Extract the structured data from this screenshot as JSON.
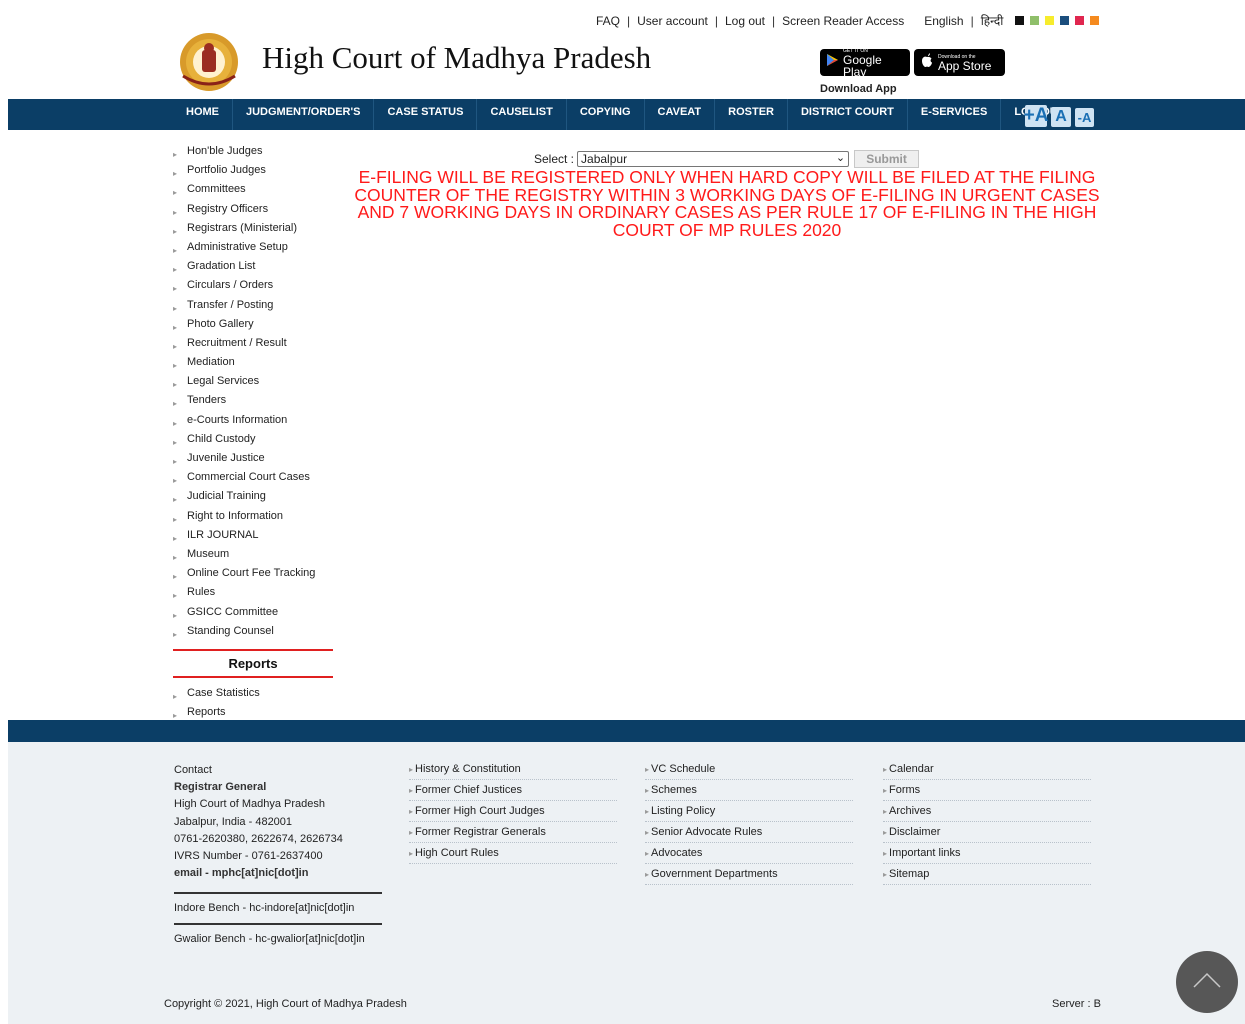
{
  "topbar": {
    "links": [
      "FAQ",
      "User account",
      "Log out",
      "Screen Reader Access"
    ],
    "lang_en": "English",
    "lang_sep": "|",
    "lang_hi": "हिन्दी",
    "swatches": [
      "#111111",
      "#8fbf6a",
      "#f7ec2c",
      "#1b4e7d",
      "#e0264f",
      "#f58a1f"
    ]
  },
  "header": {
    "title": "High Court of Madhya Pradesh",
    "google_small": "GET IT ON",
    "google_big": "Google Play",
    "apple_small": "Download on the",
    "apple_big": "App Store",
    "download_app": "Download App"
  },
  "nav": {
    "items": [
      "HOME",
      "JUDGMENT/ORDER'S",
      "CASE STATUS",
      "CAUSELIST",
      "COPYING",
      "CAVEAT",
      "ROSTER",
      "DISTRICT COURT",
      "E-SERVICES",
      "LOG OUT"
    ],
    "font_buttons": [
      "+A",
      "A",
      "-A"
    ]
  },
  "sidebar": {
    "items": [
      "Hon'ble Judges",
      "Portfolio Judges",
      "Committees",
      "Registry Officers",
      "Registrars (Ministerial)",
      "Administrative Setup",
      "Gradation List",
      "Circulars / Orders",
      "Transfer / Posting",
      "Photo Gallery",
      "Recruitment / Result",
      "Mediation",
      "Legal Services",
      "Tenders",
      "e-Courts Information",
      "Child Custody",
      "Juvenile Justice",
      "Commercial Court Cases",
      "Judicial Training",
      "Right to Information",
      "ILR JOURNAL",
      "Museum",
      "Online Court Fee Tracking",
      "Rules",
      "GSICC Committee",
      "Standing Counsel"
    ],
    "reports_heading": "Reports",
    "report_items": [
      "Case Statistics",
      "Reports"
    ]
  },
  "main": {
    "select_label": "Select :",
    "select_value": "Jabalpur",
    "submit_label": "Submit",
    "notice": "E-FILING WILL BE REGISTERED ONLY WHEN HARD COPY WILL BE FILED AT THE FILING COUNTER OF THE REGISTRY WITHIN 3 WORKING DAYS OF E-FILING IN URGENT CASES AND 7 WORKING DAYS IN ORDINARY CASES AS PER RULE 17 OF E-FILING IN THE HIGH COURT OF MP RULES 2020"
  },
  "footer": {
    "contact": {
      "heading": "Contact",
      "org": "Registrar General",
      "address1": "High Court of Madhya Pradesh",
      "address2": "Jabalpur, India - 482001",
      "phone": "0761-2620380, 2622674, 2626734",
      "ivrs": "IVRS Number - 0761-2637400",
      "email": "email - mphc[at]nic[dot]in",
      "indore": "Indore Bench - hc-indore[at]nic[dot]in",
      "gwalior": "Gwalior Bench - hc-gwalior[at]nic[dot]in"
    },
    "col1": [
      "History & Constitution",
      "Former Chief Justices",
      "Former High Court Judges",
      "Former Registrar Generals",
      "High Court Rules"
    ],
    "col2": [
      "VC Schedule",
      "Schemes",
      "Listing Policy",
      "Senior Advocate Rules",
      "Advocates",
      "Government Departments"
    ],
    "col3": [
      "Calendar",
      "Forms",
      "Archives",
      "Disclaimer",
      "Important links",
      "Sitemap"
    ],
    "copyright": "Copyright © 2021, High Court of Madhya Pradesh",
    "server": "Server : B"
  }
}
